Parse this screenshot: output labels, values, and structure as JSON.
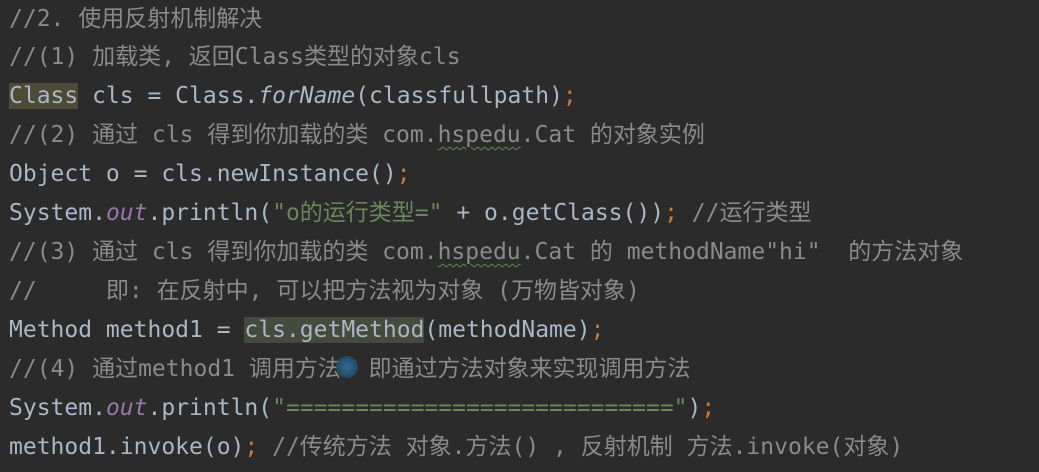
{
  "code": {
    "lines": {
      "l1": "//2. 使用反射机制解决",
      "l2": "//(1) 加载类, 返回Class类型的对象cls",
      "l3": {
        "type": "Class",
        "decl": " cls = Class.",
        "method": "forName",
        "rest": "(classfullpath)",
        "semi": ";"
      },
      "l4": {
        "pre": "//(2) 通过 cls 得到你加载的类 com.",
        "pkg": "hspedu",
        "post": ".Cat 的对象实例"
      },
      "l5": {
        "code": "Object o = cls.newInstance()",
        "semi": ";"
      },
      "l6": {
        "pre": "System.",
        "field": "out",
        "mid": ".println(",
        "str": "\"o的运行类型=\"",
        "post": " + o.getClass())",
        "semi": ";",
        "comment": " //运行类型"
      },
      "l7": {
        "pre": "//(3) 通过 cls 得到你加载的类 com.",
        "pkg": "hspedu",
        "post": ".Cat 的 methodName\"hi\"  的方法对象"
      },
      "l8": "//     即: 在反射中, 可以把方法视为对象 (万物皆对象)",
      "l9": {
        "pre": "Method method1 = ",
        "hl": "cls.getMethod",
        "post": "(methodName)",
        "semi": ";"
      },
      "l10": "//(4) 通过method1 调用方法: 即通过方法对象来实现调用方法",
      "l11": {
        "pre": "System.",
        "field": "out",
        "mid": ".println(",
        "str": "\"============================\"",
        "post": ")",
        "semi": ";"
      },
      "l12": {
        "pre": "method1.invoke(o)",
        "semi": ";",
        "comment": " //传统方法 对象.方法() , 反射机制 方法.invoke(对象)"
      }
    }
  },
  "colors": {
    "background": "#2b2b2b",
    "default_text": "#a9b7c6",
    "comment": "#8a8a8a",
    "keyword": "#cc7832",
    "string": "#6a8759",
    "static_field": "#9876aa",
    "highlight": "#4d4a36"
  }
}
